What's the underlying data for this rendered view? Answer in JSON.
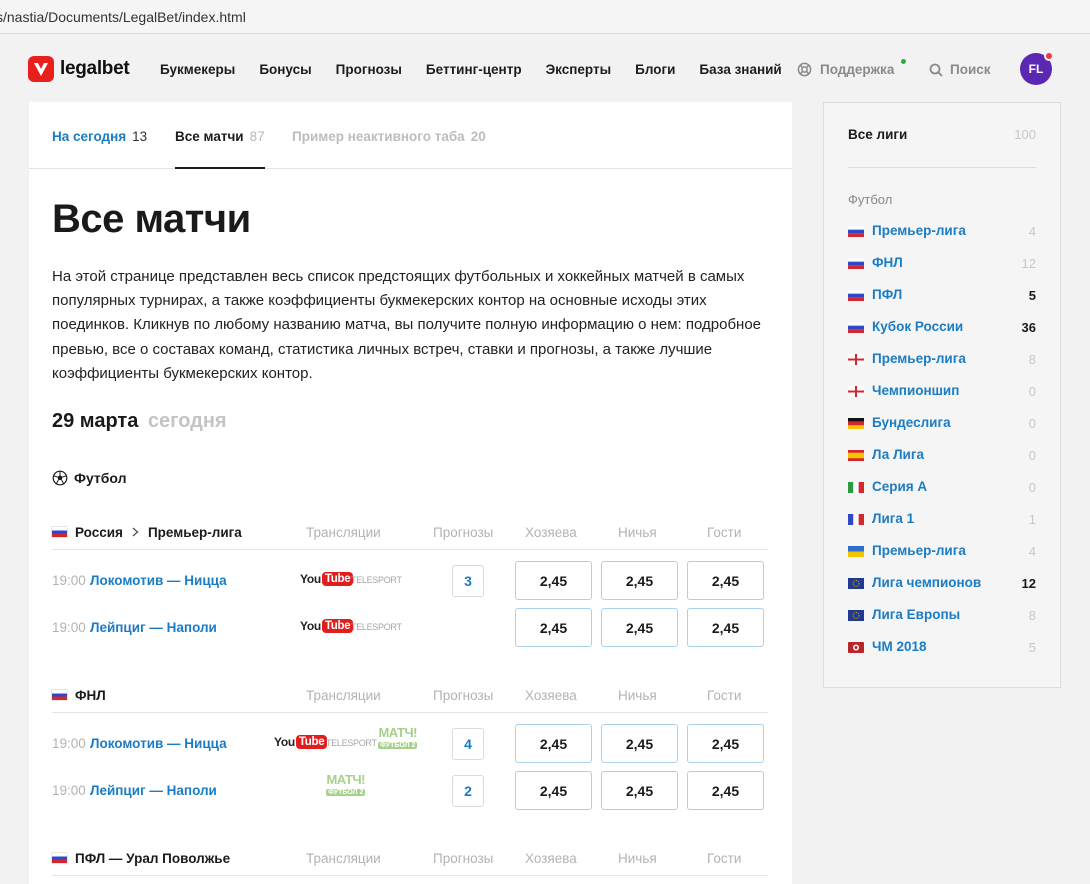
{
  "browser": {
    "url": "s/nastia/Documents/LegalBet/index.html"
  },
  "header": {
    "logo_text": "legalbet",
    "nav": [
      "Букмекеры",
      "Бонусы",
      "Прогнозы",
      "Беттинг-центр",
      "Эксперты",
      "Блоги",
      "База знаний"
    ],
    "support_label": "Поддержка",
    "search_label": "Поиск",
    "avatar_initials": "FL",
    "accent_color": "#1b7cc6",
    "brand_color": "#e8201c"
  },
  "tabs": [
    {
      "label": "На сегодня",
      "count": "13"
    },
    {
      "label": "Все матчи",
      "count": "87"
    },
    {
      "label": "Пример неактивного таба",
      "count": "20"
    }
  ],
  "page": {
    "title": "Все матчи",
    "lead": "На этой странице представлен весь список предстоящих футбольных и хоккейных матчей в самых популярных турнирах, а также коэффициенты букмекерских контор на основные исходы этих поединков. Кликнув по любому названию матча, вы получите полную информацию о нем: подробное превью, все о составах команд, статистика личных встреч, ставки и прогнозы, а также лучшие коэффициенты букмекерских контор.",
    "date": "29 марта",
    "date_suffix": "сегодня",
    "sport": "Футбол"
  },
  "columns": {
    "broadcasts": "Трансляции",
    "predictions": "Прогнозы",
    "home": "Хозяева",
    "draw": "Ничья",
    "away": "Гости"
  },
  "leagues": [
    {
      "country": "Россия",
      "name": "Премьер-лига",
      "matches": [
        {
          "time": "19:00",
          "teams": "Локомотив — Ницца",
          "predictions": "3",
          "odds": [
            "2,45",
            "2,45",
            "2,45"
          ]
        },
        {
          "time": "19:00",
          "teams": "Лейпциг — Наполи",
          "predictions": "",
          "odds": [
            "2,45",
            "2,45",
            "2,45"
          ]
        }
      ]
    },
    {
      "name": "ФНЛ",
      "matches": [
        {
          "time": "19:00",
          "teams": "Локомотив — Ницца",
          "predictions": "4",
          "odds": [
            "2,45",
            "2,45",
            "2,45"
          ]
        },
        {
          "time": "19:00",
          "teams": "Лейпциг — Наполи",
          "predictions": "2",
          "odds": [
            "2,45",
            "2,45",
            "2,45"
          ]
        }
      ]
    },
    {
      "name": "ПФЛ — Урал Поволжье",
      "matches": []
    }
  ],
  "broadcast_logos": {
    "youtube_a": "You",
    "youtube_b": "Tube",
    "telesport": "TELESPORT",
    "matchtv_big": "МАТЧ!",
    "matchtv_small": "ФУТБОЛ 2"
  },
  "sidebar": {
    "all_label": "Все лиги",
    "all_count": "100",
    "sport": "Футбол",
    "items": [
      {
        "flag": "ru",
        "label": "Премьер-лига",
        "count": "4",
        "muted": true
      },
      {
        "flag": "ru",
        "label": "ФНЛ",
        "count": "12",
        "muted": true
      },
      {
        "flag": "ru",
        "label": "ПФЛ",
        "count": "5",
        "muted": false
      },
      {
        "flag": "ru",
        "label": "Кубок России",
        "count": "36",
        "muted": false
      },
      {
        "flag": "en",
        "label": "Премьер-лига",
        "count": "8",
        "muted": true
      },
      {
        "flag": "en",
        "label": "Чемпионшип",
        "count": "0",
        "muted": true
      },
      {
        "flag": "de",
        "label": "Бундеслига",
        "count": "0",
        "muted": true
      },
      {
        "flag": "es",
        "label": "Ла Лига",
        "count": "0",
        "muted": true
      },
      {
        "flag": "it",
        "label": "Серия А",
        "count": "0",
        "muted": true
      },
      {
        "flag": "fr",
        "label": "Лига 1",
        "count": "1",
        "muted": true
      },
      {
        "flag": "ua",
        "label": "Премьер-лига",
        "count": "4",
        "muted": true
      },
      {
        "flag": "eu",
        "label": "Лига чемпионов",
        "count": "12",
        "muted": false
      },
      {
        "flag": "eu",
        "label": "Лига Европы",
        "count": "8",
        "muted": true
      },
      {
        "flag": "wc",
        "label": "ЧМ 2018",
        "count": "5",
        "muted": true
      }
    ]
  }
}
